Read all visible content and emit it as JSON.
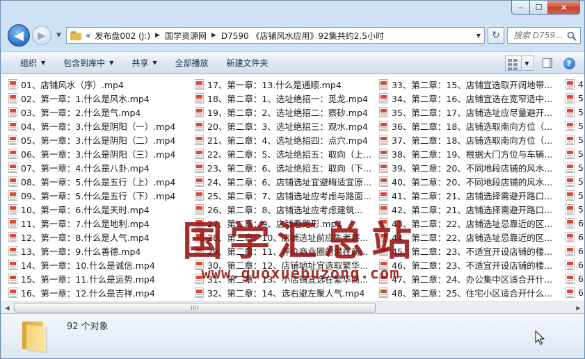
{
  "window": {
    "caption_buttons": {
      "minimize": "‒",
      "maximize": "☐",
      "close": "✕"
    }
  },
  "nav": {
    "back_glyph": "◀",
    "forward_glyph": "▶",
    "address": {
      "overflow_chevron": "«",
      "segments": [
        "发布盘002 (J:)",
        "国学资源网",
        "D7590 《店铺风水应用》92集共约2.5小时"
      ]
    },
    "search_placeholder": "搜索 D759...",
    "refresh_glyph": "↻"
  },
  "toolbar": {
    "organize": "组织",
    "include_in_library": "包含到库中",
    "share": "共享",
    "play_all": "全部播放",
    "new_folder": "新建文件夹",
    "help_glyph": "?"
  },
  "files": {
    "columns": [
      [
        "01、店铺风水（序）.mp4",
        "02、第一章：1.什么是风水.mp4",
        "03、第一章：2.什么是气.mp4",
        "04、第一章：3.什么是阴阳（一）.mp4",
        "05、第一章：3.什么是阴阳（二）.mp4",
        "06、第一章：3.什么是阴阳（三）.mp4",
        "07、第一章：4.什么是八卦.mp4",
        "08、第一章：5.什么是五行（上）.mp4",
        "09、第一章：5.什么是五行（下）.mp4",
        "10、第一章：6.什么是天时.mp4",
        "11、第一章：7.什么是地利.mp4",
        "12、第一章：8.什么是人气.mp4",
        "13、第一章：9.什么善德.mp4",
        "14、第一章：10.什么是诚信.mp4",
        "15、第一章：11.什么是运势.mp4",
        "16、第一章：12.什么是吉祥.mp4"
      ],
      [
        "17、第一章：13.什么是通顺.mp4",
        "18、第二章：1、选址绝招一：觅龙.mp4",
        "19、第二章：2、选址绝招二：察砂.mp4",
        "20、第二章：3、选址绝招三：观水.mp4",
        "21、第二章：4、选址绝招四：点穴.mp4",
        "22、第二章：5、选址绝招五：取向（上）...",
        "23、第二章：6、选址绝招五：取向（下）...",
        "24、第二章：6、店铺选址宜避晦适宜原...",
        "25、第二章：7、店铺选址应考虑与路面...",
        "26、第二章：8、店铺选址应考虑建筑...",
        "27、第二章：9、店铺看路形.mp4",
        "28、第二章：10、店铺选址前应先考察...",
        "29、第二章：11、评价商业圈的潜在商...",
        "30、第二章：12、店铺地址宜选取繁华...",
        "31、第二章：13、小店铺宜选在繁华商...",
        "32、第二章：14、选右避左聚人气.mp4"
      ],
      [
        "33、第二章：15、店铺宜选取开阔地带...",
        "34、第二章：16、店铺宜选在宽窄适中...",
        "35、第二章：17、店铺选址应尽量避开...",
        "36、第二章：18、店铺选取南向方位（...",
        "37、第二章：18、店铺选取南向方位（...",
        "38、第二章：19、根据大门方位与车辆...",
        "39、第二章：20、不同地段店铺的风水...",
        "40、第二章：20、不同地段店铺的风水...",
        "41、第二章：21、店铺选择需避开路口...",
        "42、第二章：21、店铺选择需避开路口...",
        "43、第二章：22、店铺选址忌靠近的区...",
        "44、第二章：22、店铺选址忌靠近的区...",
        "45、第二章：23、不适宜开设店铺的楼...",
        "46、第二章：23、不适宜开设店铺的楼...",
        "47、第二章：24、办公集中区适合开什...",
        "48、第二章：25、住宅小区适合开什么..."
      ],
      [
        "4",
        "5",
        "5",
        "5",
        "5",
        "5",
        "5",
        "5",
        "5",
        "5",
        "6",
        "6",
        "6",
        "6",
        "6",
        "6"
      ]
    ]
  },
  "watermark": {
    "url": "www.guoxuebuzong.com"
  },
  "status": {
    "object_count": "92 个对象"
  }
}
